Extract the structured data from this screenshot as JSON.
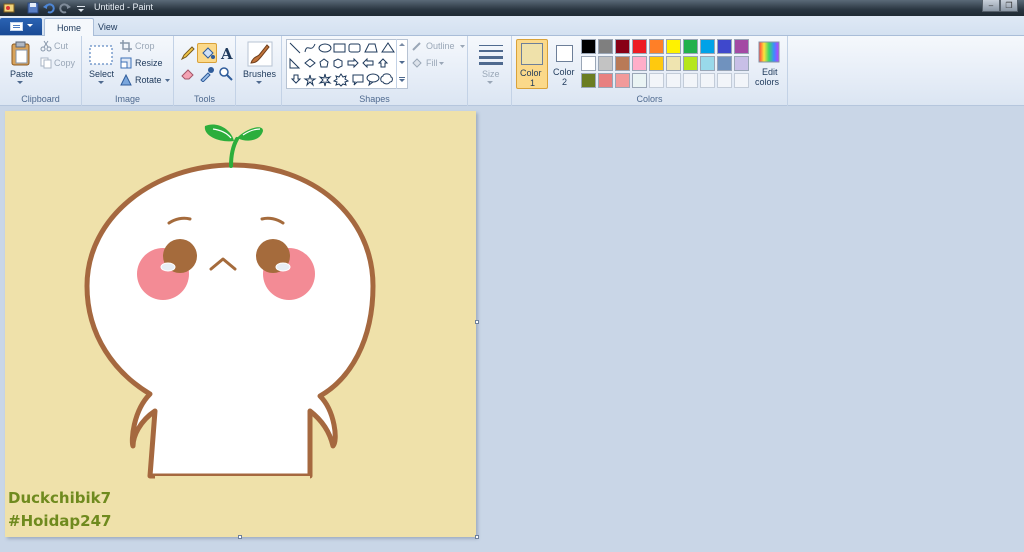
{
  "window": {
    "title": "Untitled - Paint"
  },
  "tabs": [
    {
      "label": "Home"
    },
    {
      "label": "View"
    }
  ],
  "ribbon": {
    "clipboard": {
      "group_label": "Clipboard",
      "paste": "Paste",
      "cut": "Cut",
      "copy": "Copy"
    },
    "image": {
      "group_label": "Image",
      "select": "Select",
      "crop": "Crop",
      "resize": "Resize",
      "rotate": "Rotate"
    },
    "tools": {
      "group_label": "Tools"
    },
    "brushes": {
      "label": "Brushes"
    },
    "shapes": {
      "group_label": "Shapes",
      "outline": "Outline",
      "fill": "Fill"
    },
    "size": {
      "label": "Size"
    },
    "colors": {
      "group_label": "Colors",
      "color1_label": "Color",
      "color1_num": "1",
      "color2_label": "Color",
      "color2_num": "2",
      "edit_colors": "Edit colors",
      "edit_colors_line1": "Edit",
      "edit_colors_line2": "colors",
      "color1_value": "#efe1aa",
      "color2_value": "#ffffff",
      "palette_row1": [
        "#000000",
        "#7f7f7f",
        "#880015",
        "#ed1c24",
        "#ff7f27",
        "#fff200",
        "#22b14c",
        "#00a2e8",
        "#3f48cc",
        "#a349a4"
      ],
      "palette_row2": [
        "#ffffff",
        "#c3c3c3",
        "#b97a57",
        "#ffaec9",
        "#ffc90e",
        "#efe4b0",
        "#b5e61d",
        "#99d9ea",
        "#7092be",
        "#c8bfe7"
      ],
      "palette_row3": [
        "#6b7d22",
        "#e88080",
        "#f19a9a",
        "#eaf4f4",
        "",
        "",
        "",
        "",
        "",
        ""
      ]
    }
  },
  "canvas": {
    "background": "#efe1aa",
    "watermark_line1": "Duckchibik7",
    "watermark_line2": "#Hoidap247"
  }
}
